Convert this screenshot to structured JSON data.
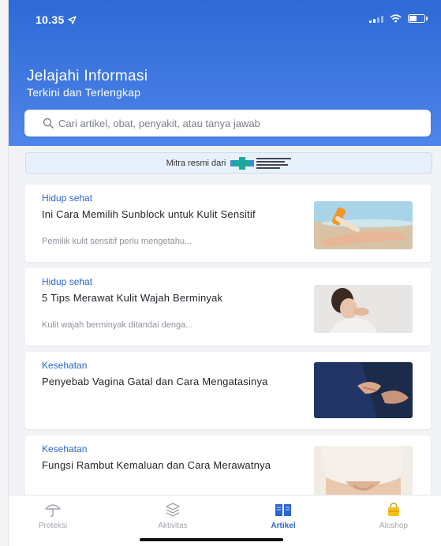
{
  "status_bar": {
    "time": "10.35"
  },
  "header": {
    "title": "Jelajahi Informasi",
    "subtitle": "Terkini dan Terlengkap"
  },
  "search": {
    "placeholder": "Cari artikel, obat, penyakit, atau tanya jawab"
  },
  "partner": {
    "label": "Mitra resmi dari"
  },
  "articles": [
    {
      "category": "Hidup sehat",
      "title": "Ini Cara Memilih Sunblock untuk Kulit Sensitif",
      "excerpt": "Pemilik kulit sensitif perlu mengetahu..."
    },
    {
      "category": "Hidup sehat",
      "title": "5 Tips Merawat Kulit Wajah Berminyak",
      "excerpt": "Kulit wajah berminyak ditandai denga..."
    },
    {
      "category": "Kesehatan",
      "title": "Penyebab Vagina Gatal dan Cara Mengatasinya",
      "excerpt": ""
    },
    {
      "category": "Kesehatan",
      "title": "Fungsi Rambut Kemaluan dan Cara Merawatnya",
      "excerpt": ""
    }
  ],
  "tabs": [
    {
      "label": "Proteksi",
      "icon": "umbrella-icon",
      "active": false
    },
    {
      "label": "Aktivitas",
      "icon": "layers-icon",
      "active": false
    },
    {
      "label": "Artikel",
      "icon": "book-icon",
      "active": true
    },
    {
      "label": "Aloshop",
      "icon": "shopping-bag-icon",
      "active": false
    }
  ],
  "colors": {
    "primary": "#2e6ad6",
    "active_tab": "#2a65d0",
    "inactive_tab": "#a2a6ad"
  }
}
